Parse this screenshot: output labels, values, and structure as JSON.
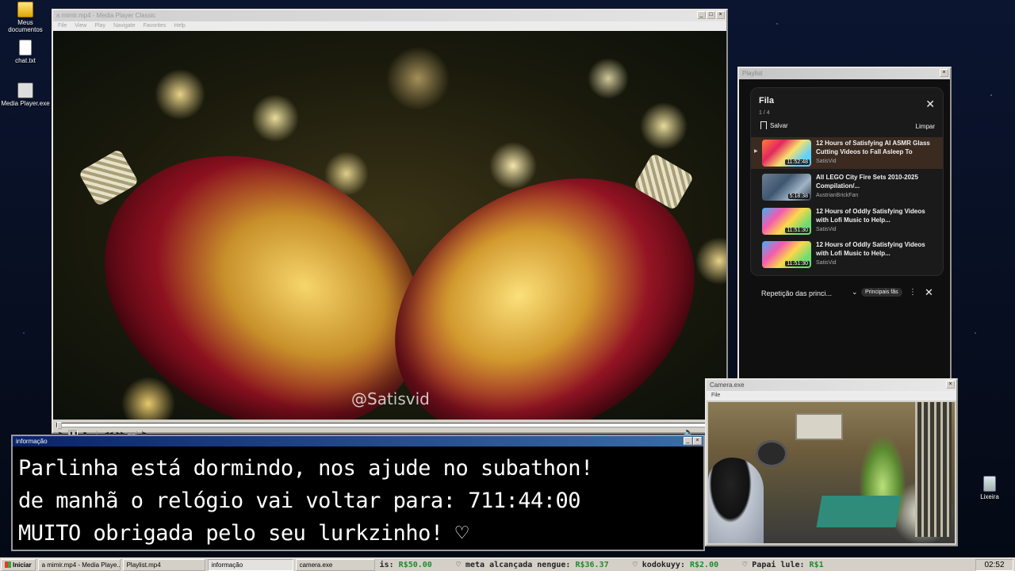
{
  "desktop": {
    "icons": [
      {
        "label": "Meus documentos"
      },
      {
        "label": "chat.txt"
      },
      {
        "label": "Media Player.exe"
      },
      {
        "label": "Lixeira"
      }
    ]
  },
  "media_player": {
    "title": "a mimir.mp4 - Media Player Classic",
    "menu": [
      "File",
      "View",
      "Play",
      "Navigate",
      "Favorites",
      "Help"
    ],
    "watermark": "@Satisvid",
    "controls": {
      "play": "▶",
      "pause": "❚❚",
      "stop": "■",
      "prev": "|◀◀",
      "rewind": "◀◀",
      "forward": "▶▶",
      "next": "▶▶|",
      "frame": "|▶"
    },
    "volume_icon": "speaker-icon",
    "progress": 0.0
  },
  "playlist": {
    "window_title": "Playlist",
    "queue_title": "Fila",
    "position": "1 / 4",
    "save_label": "Salvar",
    "clear_label": "Limpar",
    "items": [
      {
        "title": "12 Hours of Satisfying AI ASMR Glass Cutting Videos to Fall Asleep To",
        "duration": "11:52:48",
        "channel": "SatisVid",
        "current": true
      },
      {
        "title": "All LEGO City Fire Sets 2010-2025 Compilation/...",
        "duration": "5:18:38",
        "channel": "AustrianBrickFan",
        "current": false
      },
      {
        "title": "12 Hours of Oddly Satisfying Videos with Lofi Music to Help...",
        "duration": "11:51:30",
        "channel": "SatisVid",
        "current": false
      },
      {
        "title": "12 Hours of Oddly Satisfying Videos with Lofi Music to Help...",
        "duration": "11:51:30",
        "channel": "SatisVid",
        "current": false
      }
    ],
    "mix_label": "Repetição das princi...",
    "mix_badge": "Principais fãs"
  },
  "camera": {
    "title": "Camera.exe",
    "menu": [
      "File"
    ]
  },
  "info": {
    "title": "informação",
    "lines": [
      "Parlinha está dormindo, nos ajude no subathon!",
      "de manhã o relógio vai voltar para:  711:44:00",
      "MUITO obrigada pelo seu lurkzinho! ♡"
    ]
  },
  "taskbar": {
    "start_label": "Iniciar",
    "tasks": [
      "a mimir.mp4 - Media Playe...",
      "Playlist.mp4",
      "informação",
      "camera.exe"
    ],
    "ticker": [
      {
        "prefix": "is:",
        "amount": "R$50.00"
      },
      {
        "prefix": "♡ meta alcançada nengue:",
        "amount": "R$36.37"
      },
      {
        "prefix": "♡ kodokuyy:",
        "amount": "R$2.00"
      },
      {
        "prefix": "♡ Papai lule:",
        "amount": "R$1"
      }
    ],
    "clock": "02:52"
  }
}
